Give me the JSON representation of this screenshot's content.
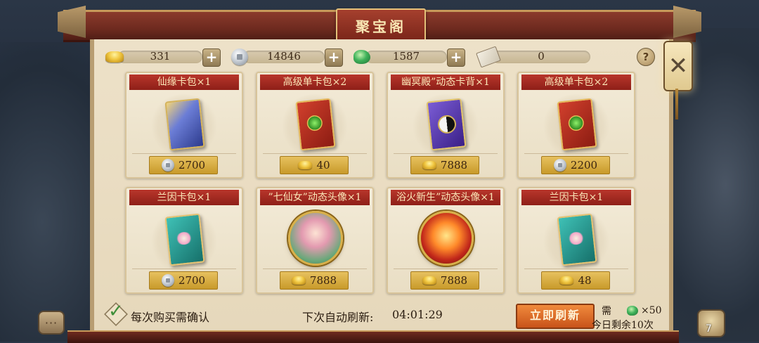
{
  "window": {
    "title": "聚宝阁"
  },
  "resources": {
    "gold": {
      "icon": "gold-ingot-icon",
      "value": "331"
    },
    "silver": {
      "icon": "silver-coin-icon",
      "value": "14846"
    },
    "jade": {
      "icon": "jade-icon",
      "value": "1587"
    },
    "scroll": {
      "icon": "scroll-icon",
      "value": "0"
    },
    "help_label": "?"
  },
  "items": [
    {
      "title": "仙缘卡包×1",
      "currency": "silver",
      "price": "2700",
      "art": "xianyuan-card-pack"
    },
    {
      "title": "高级单卡包×2",
      "currency": "gold",
      "price": "40",
      "art": "advanced-card-pack"
    },
    {
      "title": "幽冥殿”动态卡背×1",
      "currency": "gold",
      "price": "7888",
      "art": "dynamic-card-back"
    },
    {
      "title": "高级单卡包×2",
      "currency": "silver",
      "price": "2200",
      "art": "advanced-card-pack"
    },
    {
      "title": "兰因卡包×1",
      "currency": "silver",
      "price": "2700",
      "art": "lanyin-card-pack"
    },
    {
      "title": "”七仙女”动态头像×1",
      "currency": "gold",
      "price": "7888",
      "art": "fairy-avatar"
    },
    {
      "title": "浴火新生”动态头像×1",
      "currency": "gold",
      "price": "7888",
      "art": "fire-avatar"
    },
    {
      "title": "兰因卡包×1",
      "currency": "gold",
      "price": "48",
      "art": "lanyin-card-pack"
    }
  ],
  "footer": {
    "confirm_label": "每次购买需确认",
    "next_refresh_label": "下次自动刷新:",
    "next_refresh_time": "04:01:29",
    "refresh_button": "立即刷新",
    "cost_prefix": "需",
    "cost_amount": "×50",
    "remaining": "今日剩余10次",
    "chat_label": "···",
    "bag_count": "7"
  },
  "colors": {
    "accent_red": "#8e1f18",
    "parchment": "#ede1c8",
    "price_gold": "#e7c15f",
    "refresh_orange": "#f08a3c"
  }
}
